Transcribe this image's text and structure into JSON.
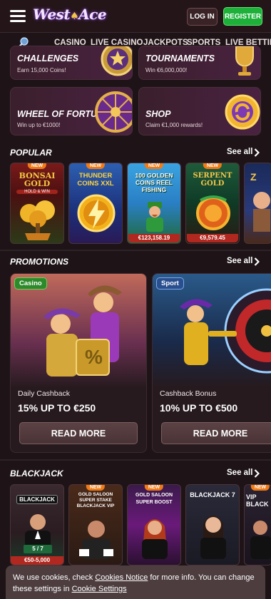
{
  "header": {
    "logo_text": "West",
    "logo_text2": "Ace",
    "login_label": "LOG IN",
    "register_label": "REGISTER"
  },
  "nav": {
    "items": [
      "CASINO",
      "LIVE CASINO",
      "JACKPOTS",
      "SPORTS",
      "LIVE BETTING"
    ]
  },
  "top_cards": [
    {
      "title": "CHALLENGES",
      "subtitle": "Earn 15,000 Coins!"
    },
    {
      "title": "TOURNAMENTS",
      "subtitle": "Win €6,000,000!"
    },
    {
      "title": "WHEEL OF FORTUNE",
      "subtitle": "Win up to €1000!"
    },
    {
      "title": "SHOP",
      "subtitle": "Claim €1,000 rewards!"
    }
  ],
  "popular": {
    "title": "POPULAR",
    "see_all": "See all",
    "games": [
      {
        "name": "BONSAI GOLD",
        "tagline": "HOLD & WIN",
        "badge": "NEW",
        "jackpot": ""
      },
      {
        "name": "THUNDER COINS XXL",
        "tagline": "",
        "badge": "NEW",
        "jackpot": ""
      },
      {
        "name": "100 GOLDEN COINS REEL FISHING",
        "tagline": "",
        "badge": "NEW",
        "jackpot": "€123,158.19"
      },
      {
        "name": "SERPENT GOLD",
        "tagline": "",
        "badge": "NEW",
        "jackpot": "€9,579.45"
      }
    ]
  },
  "promotions": {
    "title": "PROMOTIONS",
    "see_all": "See all",
    "items": [
      {
        "tag": "Casino",
        "tag_color": "#2c8a2a",
        "label": "Daily Cashback",
        "offer": "15% UP TO €250",
        "button": "READ MORE"
      },
      {
        "tag": "Sport",
        "tag_color": "#2a4f8f",
        "label": "Cashback Bonus",
        "offer": "10% UP TO €500",
        "button": "READ MORE"
      }
    ]
  },
  "blackjack": {
    "title": "BLACKJACK",
    "see_all": "See all",
    "games": [
      {
        "name": "BLACKJACK",
        "badge": "",
        "limits": "€50-5,000",
        "score": "5 / 7"
      },
      {
        "name": "GOLD SALOON SUPER STAKE BLACKJACK VIP",
        "badge": "NEW",
        "limits": "",
        "score": ""
      },
      {
        "name": "GOLD SALOON SUPER BOOST",
        "badge": "NEW",
        "limits": "",
        "score": ""
      },
      {
        "name": "BLACKJACK 7",
        "badge": "",
        "limits": "",
        "score": ""
      },
      {
        "name": "VIP BLACK",
        "badge": "NEW",
        "limits": "",
        "score": ""
      }
    ]
  },
  "cookie": {
    "text_before": "We use cookies, check ",
    "link1": "Cookies Notice",
    "text_middle": " for more info. You can change these settings in ",
    "link2": "Cookie Settings"
  },
  "colors": {
    "background": "#1e1417",
    "register_green": "#1db13a",
    "badge_orange": "#ef7a16",
    "jackpot_red": "#b0281f"
  }
}
